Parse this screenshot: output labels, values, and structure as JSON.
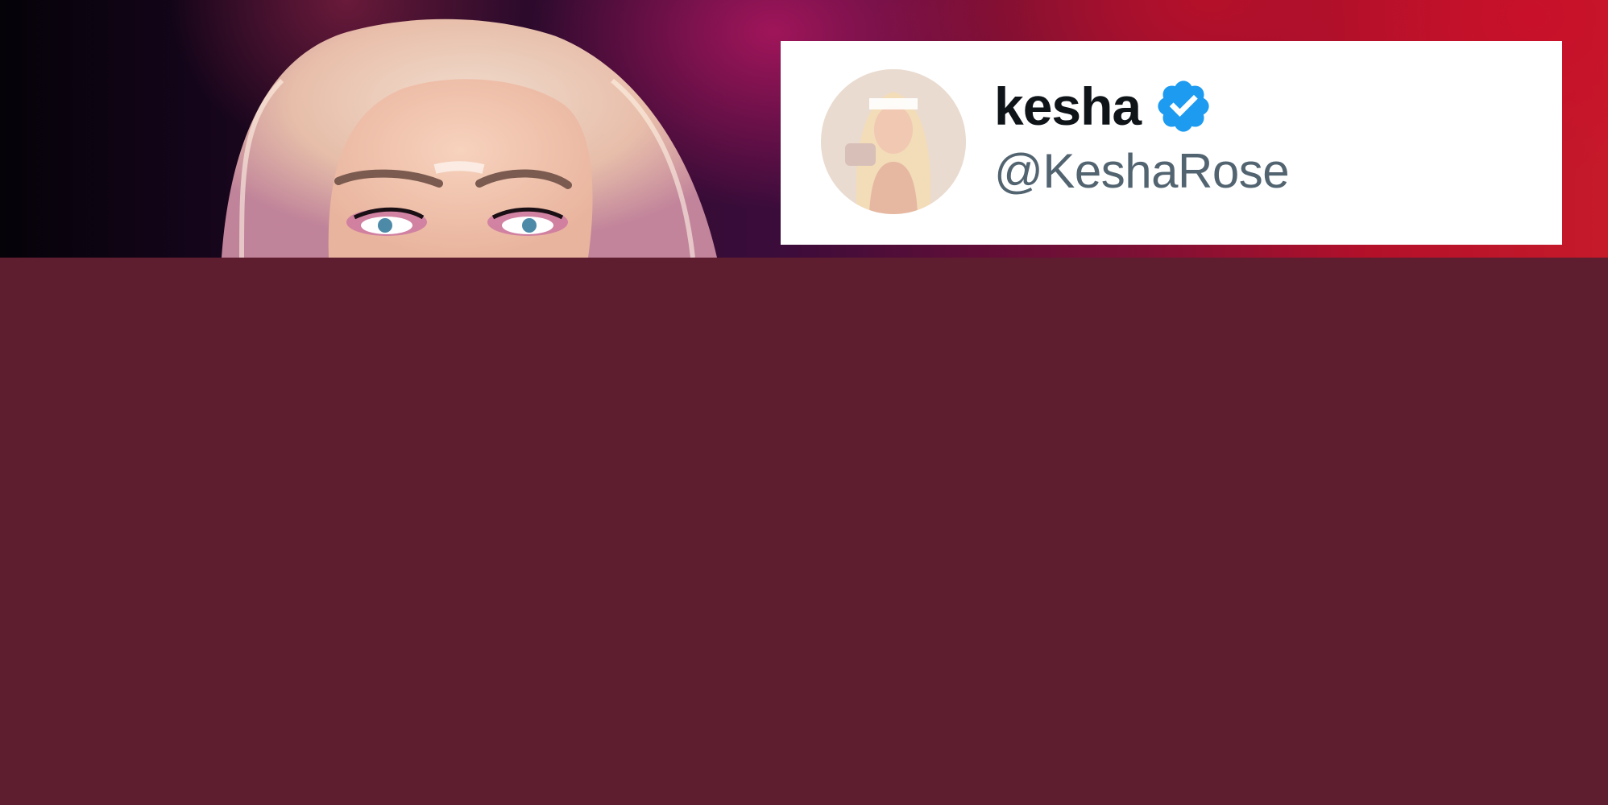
{
  "tweet": {
    "display_name": "kesha",
    "handle": "@KeshaRose",
    "verified_icon": "verified-badge-icon",
    "verified_color": "#1d9bf0"
  },
  "colors": {
    "panel": "#5f1d30",
    "card": "#ffffff",
    "name_text": "#0f1419",
    "handle_text": "#536471"
  }
}
